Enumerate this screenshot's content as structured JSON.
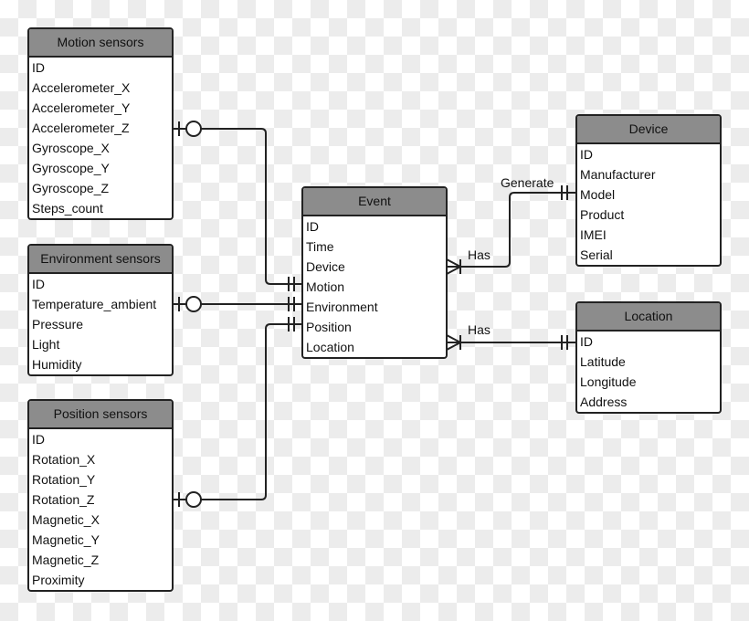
{
  "entities": {
    "motion": {
      "title": "Motion sensors",
      "fields": [
        "ID",
        "Accelerometer_X",
        "Accelerometer_Y",
        "Accelerometer_Z",
        "Gyroscope_X",
        "Gyroscope_Y",
        "Gyroscope_Z",
        "Steps_count"
      ]
    },
    "environment": {
      "title": "Environment sensors",
      "fields": [
        "ID",
        "Temperature_ambient",
        "Pressure",
        "Light",
        "Humidity"
      ]
    },
    "position": {
      "title": "Position sensors",
      "fields": [
        "ID",
        "Rotation_X",
        "Rotation_Y",
        "Rotation_Z",
        "Magnetic_X",
        "Magnetic_Y",
        "Magnetic_Z",
        "Proximity"
      ]
    },
    "event": {
      "title": "Event",
      "fields": [
        "ID",
        "Time",
        "Device",
        "Motion",
        "Environment",
        "Position",
        "Location"
      ]
    },
    "device": {
      "title": "Device",
      "fields": [
        "ID",
        "Manufacturer",
        "Model",
        "Product",
        "IMEI",
        "Serial"
      ]
    },
    "location": {
      "title": "Location",
      "fields": [
        "ID",
        "Latitude",
        "Longitude",
        "Address"
      ]
    }
  },
  "relationships": {
    "generate": "Generate",
    "has_device": "Has",
    "has_location": "Has"
  },
  "colors": {
    "header": "#8c8c8c",
    "line": "#222222"
  }
}
